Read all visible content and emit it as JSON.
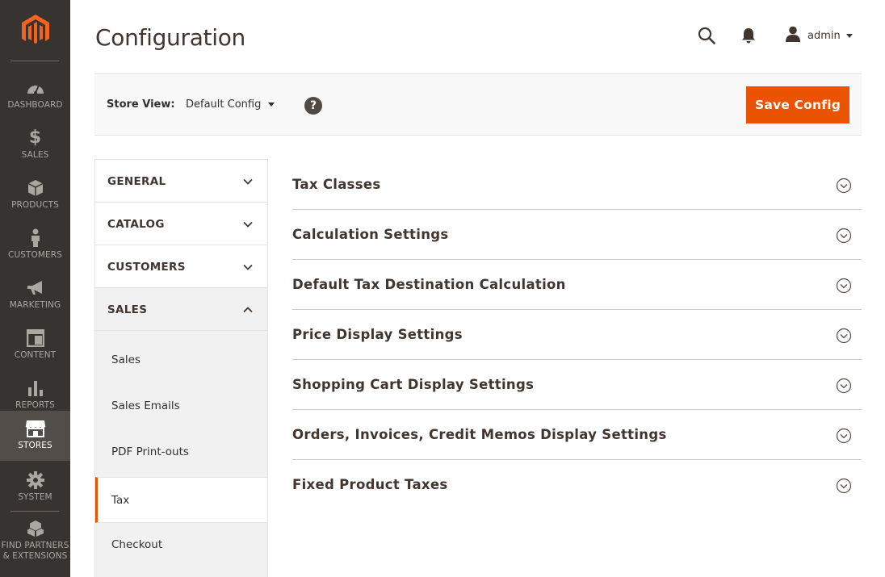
{
  "nav": {
    "items": [
      {
        "label": "DASHBOARD",
        "icon": "dashboard-icon"
      },
      {
        "label": "SALES",
        "icon": "dollar-icon"
      },
      {
        "label": "PRODUCTS",
        "icon": "box-icon"
      },
      {
        "label": "CUSTOMERS",
        "icon": "person-icon"
      },
      {
        "label": "MARKETING",
        "icon": "megaphone-icon"
      },
      {
        "label": "CONTENT",
        "icon": "layout-icon"
      },
      {
        "label": "REPORTS",
        "icon": "bar-chart-icon"
      },
      {
        "label": "STORES",
        "icon": "store-icon"
      },
      {
        "label": "SYSTEM",
        "icon": "gear-icon"
      },
      {
        "label": "FIND PARTNERS & EXTENSIONS",
        "icon": "cubes-icon"
      }
    ],
    "active": "STORES"
  },
  "header": {
    "title": "Configuration",
    "user": "admin"
  },
  "store_bar": {
    "label": "Store View:",
    "value": "Default Config",
    "help": "?",
    "save_label": "Save Config"
  },
  "tabs": {
    "groups": [
      {
        "label": "GENERAL",
        "expanded": false
      },
      {
        "label": "CATALOG",
        "expanded": false
      },
      {
        "label": "CUSTOMERS",
        "expanded": false
      },
      {
        "label": "SALES",
        "expanded": true
      }
    ],
    "sales_items": [
      "Sales",
      "Sales Emails",
      "PDF Print-outs",
      "Tax",
      "Checkout"
    ],
    "active_item": "Tax"
  },
  "sections": [
    "Tax Classes",
    "Calculation Settings",
    "Default Tax Destination Calculation",
    "Price Display Settings",
    "Shopping Cart Display Settings",
    "Orders, Invoices, Credit Memos Display Settings",
    "Fixed Product Taxes"
  ],
  "colors": {
    "accent": "#eb5202",
    "nav_bg": "#373330",
    "nav_active": "#524d49"
  }
}
